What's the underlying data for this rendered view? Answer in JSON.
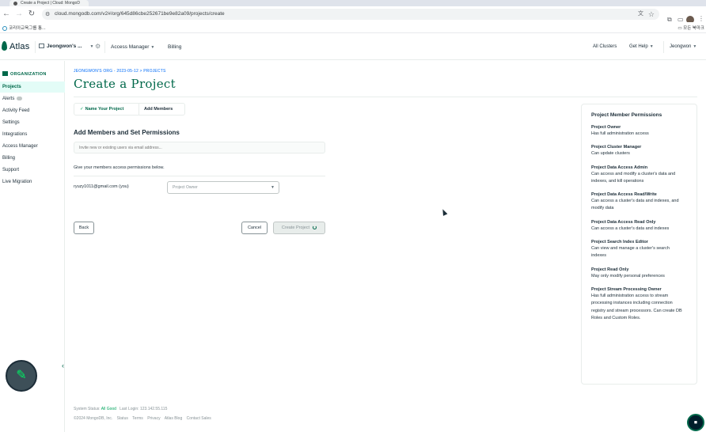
{
  "browser": {
    "tab_title": "Create a Project | Cloud: MongoD",
    "url": "cloud.mongodb.com/v2#/org/645d86cbe252671be9e82a09/projects/create",
    "bookmark": "코리아교육그룹 통...",
    "bookmarks_right": "모든 북마크"
  },
  "topnav": {
    "logo": "Atlas",
    "org_name": "Jeongwon's ...",
    "access_manager": "Access Manager",
    "billing": "Billing",
    "all_clusters": "All Clusters",
    "get_help": "Get Help",
    "user": "Jeongwon"
  },
  "sidebar": {
    "heading": "ORGANIZATION",
    "items": [
      {
        "label": "Projects"
      },
      {
        "label": "Alerts"
      },
      {
        "label": "Activity Feed"
      },
      {
        "label": "Settings"
      },
      {
        "label": "Integrations"
      },
      {
        "label": "Access Manager"
      },
      {
        "label": "Billing"
      },
      {
        "label": "Support"
      },
      {
        "label": "Live Migration"
      }
    ]
  },
  "main": {
    "breadcrumb": "JEONGWON'S ORG - 2023-05-12 > PROJECTS",
    "title": "Create a Project",
    "steps": [
      {
        "label": "Name Your Project",
        "done": true
      },
      {
        "label": "Add Members",
        "done": false
      }
    ],
    "section_title": "Add Members and Set Permissions",
    "invite_placeholder": "Invite new or existing users via email address...",
    "permissions_help": "Give your members access permissions below.",
    "member_email": "ryuzy1011@gmail.com (you)",
    "member_role": "Project Owner",
    "back_label": "Back",
    "cancel_label": "Cancel",
    "create_label": "Create Project"
  },
  "permissions_panel": {
    "title": "Project Member Permissions",
    "entries": [
      {
        "name": "Project Owner",
        "desc": "Has full administration access"
      },
      {
        "name": "Project Cluster Manager",
        "desc": "Can update clusters"
      },
      {
        "name": "Project Data Access Admin",
        "desc": "Can access and modify a cluster's data and indexes, and kill operations"
      },
      {
        "name": "Project Data Access Read/Write",
        "desc": "Can access a cluster's data and indexes, and modify data"
      },
      {
        "name": "Project Data Access Read Only",
        "desc": "Can access a cluster's data and indexes"
      },
      {
        "name": "Project Search Index Editor",
        "desc": "Can view and manage a cluster's search indexes"
      },
      {
        "name": "Project Read Only",
        "desc": "May only modify personal preferences"
      },
      {
        "name": "Project Stream Processing Owner",
        "desc": "Has full administration access to stream processing instances including connection registry and stream processors. Can create DB Roles and Custom Roles."
      }
    ]
  },
  "footer": {
    "status_label": "System Status:",
    "status_value": "All Good",
    "last_login": "Last Login: 123.142.55.115",
    "copyright": "©2024 MongoDB, Inc.",
    "links": [
      "Status",
      "Terms",
      "Privacy",
      "Atlas Blog",
      "Contact Sales"
    ]
  },
  "colors": {
    "brand_green": "#00684a",
    "link_blue": "#016bf8",
    "success_green": "#00a35c"
  }
}
